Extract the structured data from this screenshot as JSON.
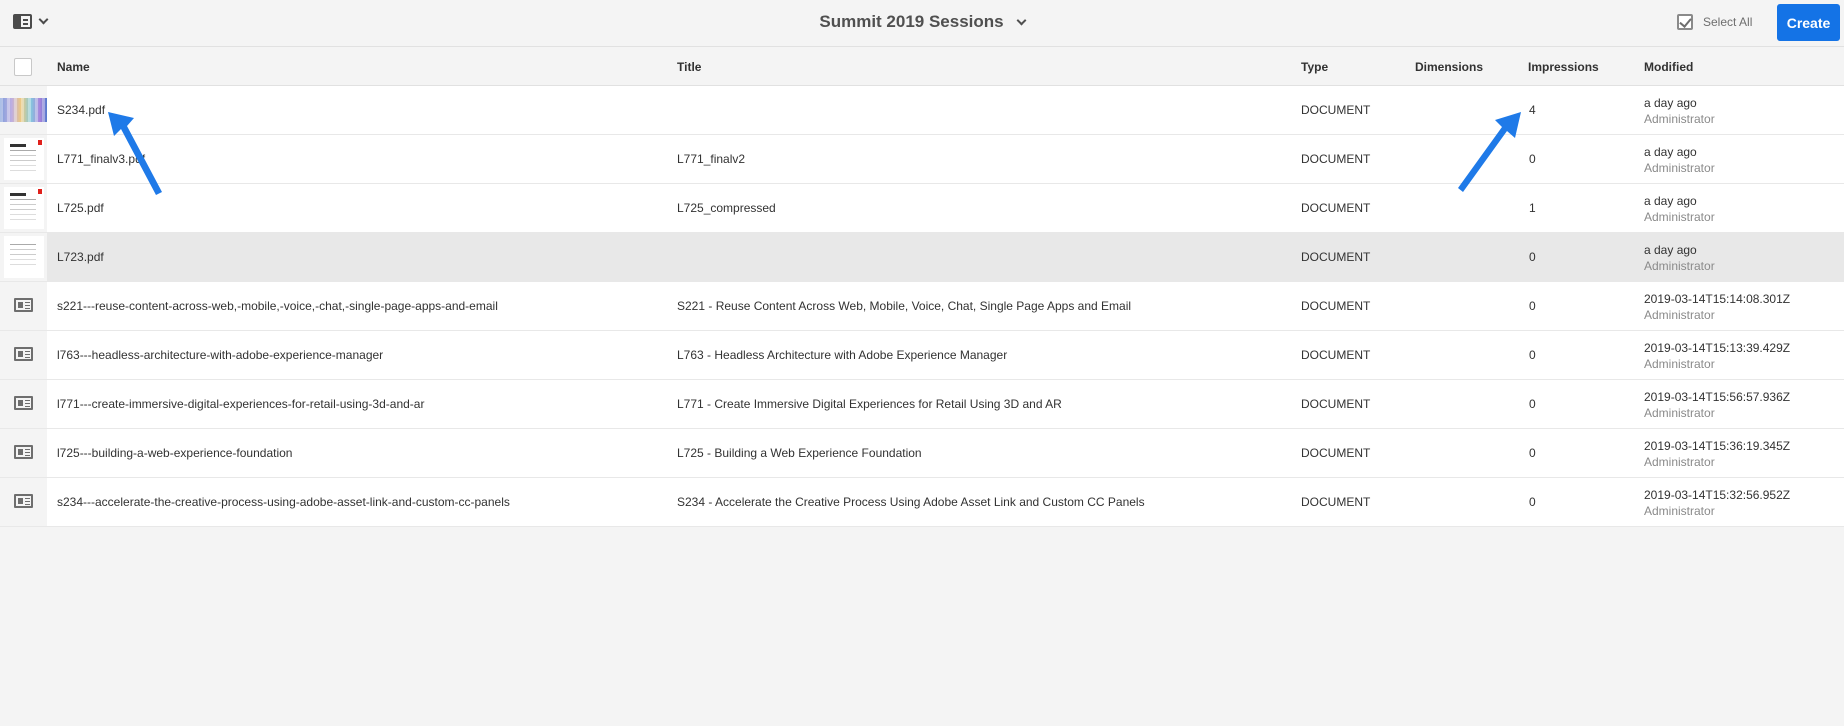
{
  "toolbar": {
    "collection_title": "Summit 2019 Sessions",
    "select_all_label": "Select All",
    "create_label": "Create"
  },
  "columns": {
    "name": "Name",
    "title": "Title",
    "type": "Type",
    "dimensions": "Dimensions",
    "impressions": "Impressions",
    "modified": "Modified"
  },
  "rows": [
    {
      "name": "S234.pdf",
      "title": "",
      "type": "DOCUMENT",
      "dimensions": "",
      "impressions": "4",
      "modified": "a day ago",
      "modified_by": "Administrator",
      "thumb": "pdf-colorful"
    },
    {
      "name": "L771_finalv3.pdf",
      "title": "L771_finalv2",
      "type": "DOCUMENT",
      "dimensions": "",
      "impressions": "0",
      "modified": "a day ago",
      "modified_by": "Administrator",
      "thumb": "pdf-page"
    },
    {
      "name": "L725.pdf",
      "title": "L725_compressed",
      "type": "DOCUMENT",
      "dimensions": "",
      "impressions": "1",
      "modified": "a day ago",
      "modified_by": "Administrator",
      "thumb": "pdf-page"
    },
    {
      "name": "L723.pdf",
      "title": "",
      "type": "DOCUMENT",
      "dimensions": "",
      "impressions": "0",
      "modified": "a day ago",
      "modified_by": "Administrator",
      "thumb": "pdf-page"
    },
    {
      "name": "s221---reuse-content-across-web,-mobile,-voice,-chat,-single-page-apps-and-email",
      "title": "S221 - Reuse Content Across Web, Mobile, Voice, Chat, Single Page Apps and Email",
      "type": "DOCUMENT",
      "dimensions": "",
      "impressions": "0",
      "modified": "2019-03-14T15:14:08.301Z",
      "modified_by": "Administrator",
      "thumb": "content-fragment-icon"
    },
    {
      "name": "l763---headless-architecture-with-adobe-experience-manager",
      "title": "L763 - Headless Architecture with Adobe Experience Manager",
      "type": "DOCUMENT",
      "dimensions": "",
      "impressions": "0",
      "modified": "2019-03-14T15:13:39.429Z",
      "modified_by": "Administrator",
      "thumb": "content-fragment-icon"
    },
    {
      "name": "l771---create-immersive-digital-experiences-for-retail-using-3d-and-ar",
      "title": "L771 - Create Immersive Digital Experiences for Retail Using 3D and AR",
      "type": "DOCUMENT",
      "dimensions": "",
      "impressions": "0",
      "modified": "2019-03-14T15:56:57.936Z",
      "modified_by": "Administrator",
      "thumb": "content-fragment-icon"
    },
    {
      "name": "l725---building-a-web-experience-foundation",
      "title": "L725 - Building a Web Experience Foundation",
      "type": "DOCUMENT",
      "dimensions": "",
      "impressions": "0",
      "modified": "2019-03-14T15:36:19.345Z",
      "modified_by": "Administrator",
      "thumb": "content-fragment-icon"
    },
    {
      "name": "s234---accelerate-the-creative-process-using-adobe-asset-link-and-custom-cc-panels",
      "title": "S234 - Accelerate the Creative Process Using Adobe Asset Link and Custom CC Panels",
      "type": "DOCUMENT",
      "dimensions": "",
      "impressions": "0",
      "modified": "2019-03-14T15:32:56.952Z",
      "modified_by": "Administrator",
      "thumb": "content-fragment-icon"
    }
  ],
  "colors": {
    "accent": "#1473e6",
    "annotation_arrow": "#1f7ae8"
  }
}
